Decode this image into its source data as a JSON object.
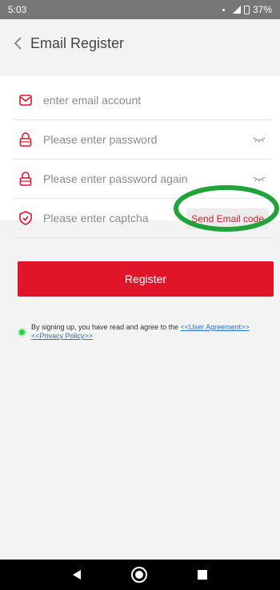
{
  "status": {
    "time": "5:03",
    "battery": "37%"
  },
  "header": {
    "title": "Email Register",
    "back_icon": "chevron-left-icon"
  },
  "form": {
    "email_placeholder": "enter email account",
    "password_placeholder": "Please enter password",
    "password_again_placeholder": "Please enter password again",
    "captcha_placeholder": "Please enter captcha",
    "send_code_label": "Send Email code"
  },
  "register_label": "Register",
  "agreement": {
    "text": "By signing up, you have read and agree to the ",
    "user_agreement_link": "<<User Agreement>>",
    "privacy_link": "<<Privacy Policy>>"
  },
  "colors": {
    "accent": "#e0152a",
    "status_bar": "#777777",
    "highlight": "#1fa33a"
  }
}
